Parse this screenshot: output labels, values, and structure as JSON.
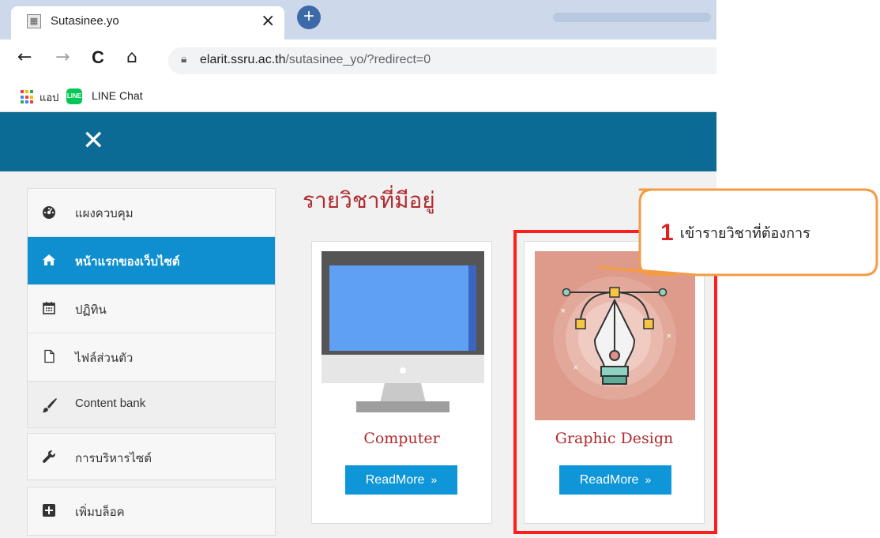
{
  "browser": {
    "tab_title": "Sutasinee.yo",
    "tab_close": "×",
    "new_tab": "+",
    "url_domain": "elarit.ssru.ac.th",
    "url_path": "/sutasinee_yo/?redirect=0",
    "bookmarks": [
      {
        "label": "แอป",
        "icon": "apps-grid-icon"
      },
      {
        "label": "LINE Chat",
        "icon": "line-icon"
      }
    ]
  },
  "header": {
    "close_glyph": "✕"
  },
  "sidebar": {
    "items": [
      {
        "label": "แผงควบคุม",
        "icon": "dashboard-icon",
        "active": false
      },
      {
        "label": "หน้าแรกของเว็บไซต์",
        "icon": "home-icon",
        "active": true
      },
      {
        "label": "ปฏิทิน",
        "icon": "calendar-icon",
        "active": false
      },
      {
        "label": "ไฟล์ส่วนตัว",
        "icon": "file-icon",
        "active": false
      },
      {
        "label": "Content bank",
        "icon": "paintbrush-icon",
        "active": false
      },
      {
        "label": "การบริหารไซต์",
        "icon": "wrench-icon",
        "active": false
      },
      {
        "label": "เพิ่มบล็อค",
        "icon": "plus-square-icon",
        "active": false
      }
    ]
  },
  "courses": {
    "heading": "รายวิชาที่มีอยู่",
    "items": [
      {
        "title": "Computer",
        "button": "ReadMore",
        "image": "monitor-illustration"
      },
      {
        "title": "Graphic Design",
        "button": "ReadMore",
        "image": "pen-tool-illustration"
      }
    ]
  },
  "annotation": {
    "number": "1",
    "text": "เข้ารายวิชาที่ต้องการ",
    "highlight_color": "#ff1e1e",
    "callout_border_color": "#f39c45"
  }
}
